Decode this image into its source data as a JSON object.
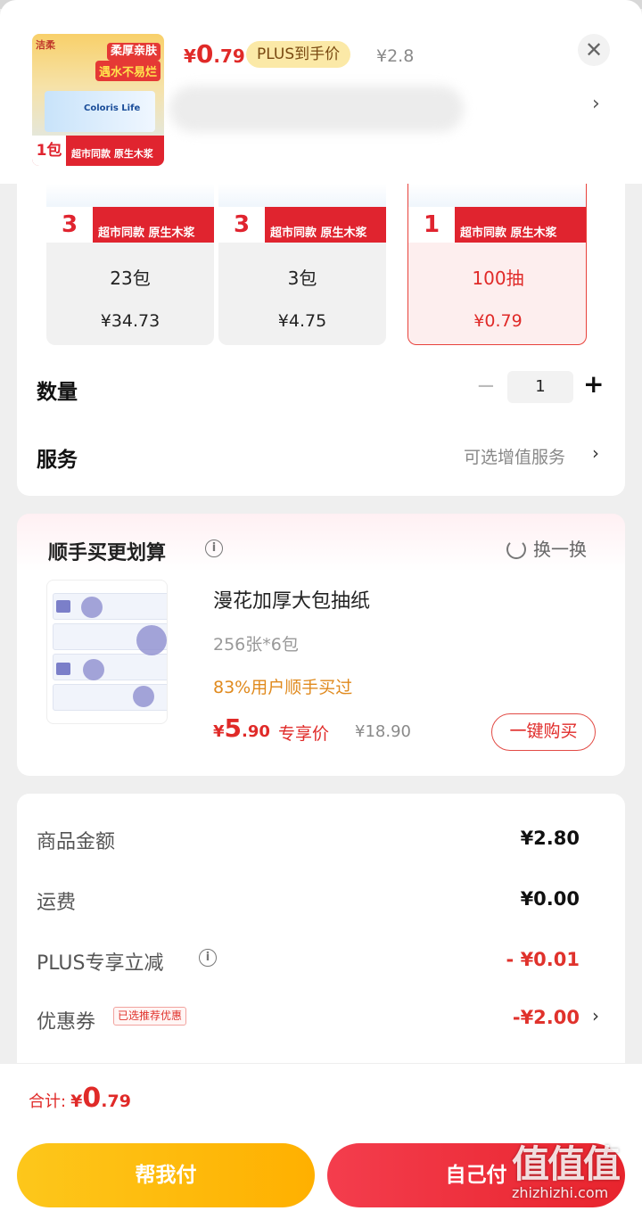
{
  "header": {
    "thumb": {
      "brand": "洁柔",
      "slogan_line1": "柔厚亲肤",
      "slogan_line2": "遇水不易烂",
      "box_text": "Coloris Life",
      "pack_count": "1包",
      "pack_text": "超市同款 原生木浆"
    },
    "price_yen": "¥",
    "price_int": "0",
    "price_dec": ".79",
    "plus_tag": "PLUS到手价",
    "original_price": "¥2.8",
    "close_icon": "close-icon",
    "chevron": "›"
  },
  "options": [
    {
      "sticker_num": "3",
      "sticker_text": "超市同款 原生木浆",
      "label": "23包",
      "price": "¥34.73",
      "selected": false
    },
    {
      "sticker_num": "3",
      "sticker_text": "超市同款 原生木浆",
      "label": "3包",
      "price": "¥4.75",
      "selected": false
    },
    {
      "sticker_num": "1",
      "sticker_text": "超市同款 原生木浆",
      "label": "100抽",
      "price": "¥0.79",
      "selected": true
    }
  ],
  "quantity": {
    "label": "数量",
    "minus": "−",
    "value": "1",
    "plus": "+"
  },
  "service": {
    "label": "服务",
    "value": "可选增值服务",
    "chevron": "›"
  },
  "addon": {
    "title": "顺手买更划算",
    "info": "i",
    "swap_label": "换一换",
    "product": {
      "title": "漫花加厚大包抽纸",
      "spec": "256张*6包",
      "users": "83%用户顺手买过",
      "price_yen": "¥",
      "price_int": "5",
      "price_dec": ".90",
      "exclusive": "专享价",
      "original": "¥18.90",
      "buy_label": "一键购买"
    }
  },
  "summary": {
    "rows": [
      {
        "label": "商品金额",
        "value": "¥2.80"
      },
      {
        "label": "运费",
        "value": "¥0.00"
      },
      {
        "label": "PLUS专享立减",
        "value": "- ¥0.01"
      },
      {
        "label": "优惠券",
        "value": "-¥2.00"
      }
    ],
    "coupon_tag": "已选推荐优惠",
    "chevron": "›"
  },
  "footer": {
    "total_label": "合计:",
    "total_yen": "¥",
    "total_int": "0",
    "total_dec": ".79",
    "help_pay": "帮我付",
    "self_pay": "自己付"
  },
  "watermark": {
    "big": "值值值",
    "small": "zhizhizhi.com"
  },
  "colors": {
    "accent_red": "#e02a28",
    "plus_tag_bg": "#fbe9a7",
    "help_btn": "#fdc71b",
    "pay_btn": "#e8242d"
  }
}
